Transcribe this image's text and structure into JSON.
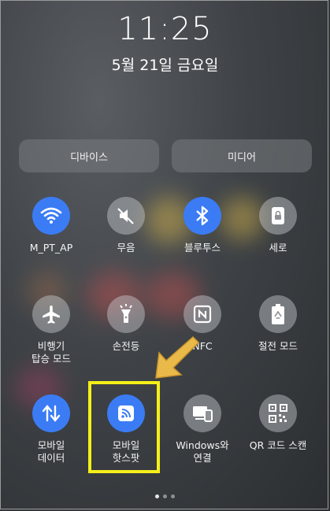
{
  "status": {
    "time": "11:25",
    "date": "5월 21일 금요일"
  },
  "pills": {
    "device": "디바이스",
    "media": "미디어"
  },
  "tiles": [
    {
      "label1": "M_PT_AP",
      "label2": "",
      "icon": "wifi-icon",
      "state": "on"
    },
    {
      "label1": "무음",
      "label2": "",
      "icon": "mute-icon",
      "state": "off"
    },
    {
      "label1": "블루투스",
      "label2": "",
      "icon": "bluetooth-icon",
      "state": "on"
    },
    {
      "label1": "세로",
      "label2": "",
      "icon": "portrait-lock-icon",
      "state": "off"
    },
    {
      "label1": "비행기",
      "label2": "탑승 모드",
      "icon": "airplane-icon",
      "state": "off"
    },
    {
      "label1": "손전등",
      "label2": "",
      "icon": "flashlight-icon",
      "state": "off"
    },
    {
      "label1": "NFC",
      "label2": "",
      "icon": "nfc-icon",
      "state": "off"
    },
    {
      "label1": "절전 모드",
      "label2": "",
      "icon": "battery-saver-icon",
      "state": "off"
    },
    {
      "label1": "모바일",
      "label2": "데이터",
      "icon": "mobile-data-icon",
      "state": "on"
    },
    {
      "label1": "모바일",
      "label2": "핫스팟",
      "icon": "hotspot-icon",
      "state": "on"
    },
    {
      "label1": "Windows와",
      "label2": "연결",
      "icon": "link-to-windows-icon",
      "state": "off"
    },
    {
      "label1": "QR 코드 스캔",
      "label2": "",
      "icon": "qr-scan-icon",
      "state": "off"
    }
  ],
  "colors": {
    "accent": "#3b7cf5",
    "highlight": "#f5ef1a",
    "arrow": "#e9b94a"
  }
}
